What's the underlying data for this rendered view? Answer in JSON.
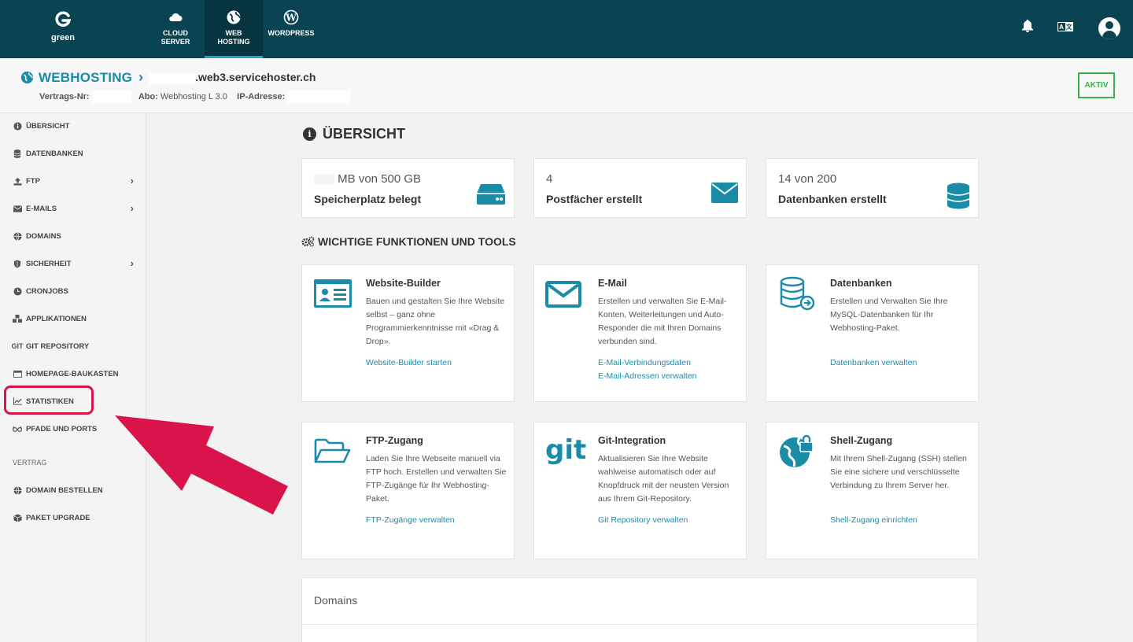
{
  "topnav": {
    "logo_text": "green",
    "tabs": [
      {
        "label_line1": "CLOUD",
        "label_line2": "SERVER",
        "icon": "cloud-icon"
      },
      {
        "label_line1": "WEB",
        "label_line2": "HOSTING",
        "icon": "globe-icon",
        "active": true
      },
      {
        "label_line1": "WORDPRESS",
        "label_line2": "",
        "icon": "wordpress-icon"
      }
    ],
    "icons": [
      "bell-icon",
      "translate-icon",
      "user-avatar-icon"
    ]
  },
  "header": {
    "title": "WEBHOSTING",
    "domain_suffix": ".web3.servicehoster.ch",
    "contract_label": "Vertrags-Nr:",
    "abo_label": "Abo:",
    "abo_value": "Webhosting L 3.0",
    "ip_label": "IP-Adresse:",
    "status": "AKTIV"
  },
  "sidebar": {
    "items": [
      {
        "label": "ÜBERSICHT",
        "icon": "info-icon"
      },
      {
        "label": "DATENBANKEN",
        "icon": "database-icon"
      },
      {
        "label": "FTP",
        "icon": "upload-icon",
        "has_submenu": true
      },
      {
        "label": "E-MAILS",
        "icon": "envelope-icon",
        "has_submenu": true
      },
      {
        "label": "DOMAINS",
        "icon": "globe-icon"
      },
      {
        "label": "SICHERHEIT",
        "icon": "shield-icon",
        "has_submenu": true
      },
      {
        "label": "CRONJOBS",
        "icon": "clock-icon"
      },
      {
        "label": "APPLIKATIONEN",
        "icon": "cubes-icon"
      },
      {
        "label": "GIT REPOSITORY",
        "icon": "git-icon"
      },
      {
        "label": "HOMEPAGE-BAUKASTEN",
        "icon": "window-icon"
      },
      {
        "label": "STATISTIKEN",
        "icon": "chart-line-icon"
      },
      {
        "label": "PFADE UND PORTS",
        "icon": "glasses-icon"
      }
    ],
    "section_label": "VERTRAG",
    "contract_items": [
      {
        "label": "DOMAIN BESTELLEN",
        "icon": "globe-icon"
      },
      {
        "label": "PAKET UPGRADE",
        "icon": "box-icon"
      }
    ]
  },
  "main": {
    "title": "ÜBERSICHT",
    "stats": [
      {
        "value": "MB von 500 GB",
        "label": "Speicherplatz belegt",
        "icon": "hdd-icon"
      },
      {
        "value": "4",
        "label": "Postfächer erstellt",
        "icon": "envelope-icon"
      },
      {
        "value": "14 von 200",
        "label": "Datenbanken erstellt",
        "icon": "database-icon"
      }
    ],
    "tools_title": "WICHTIGE FUNKTIONEN UND TOOLS",
    "cards": [
      {
        "title": "Website-Builder",
        "desc": "Bauen und gestalten Sie Ihre Website selbst – ganz ohne Programmierkenntnisse mit «Drag & Drop».",
        "links": [
          "Website-Builder starten"
        ],
        "icon": "id-card-icon"
      },
      {
        "title": "E-Mail",
        "desc": "Erstellen und verwalten Sie E-Mail-Konten, Weiterleitungen und Auto-Responder die mit Ihren Domains verbunden sind.",
        "links": [
          "E-Mail-Verbindungsdaten",
          "E-Mail-Adressen verwalten"
        ],
        "icon": "envelope-icon"
      },
      {
        "title": "Datenbanken",
        "desc": "Erstellen und Verwalten Sie Ihre MySQL-Datenbanken für Ihr Webhosting-Paket.",
        "links": [
          "Datenbanken verwalten"
        ],
        "icon": "database-arrow-icon"
      },
      {
        "title": "FTP-Zugang",
        "desc": "Laden Sie Ihre Webseite manuell via FTP hoch. Erstellen und verwalten Sie FTP-Zugänge für Ihr Webhosting-Paket.",
        "links": [
          "FTP-Zugänge verwalten"
        ],
        "icon": "folder-open-icon"
      },
      {
        "title": "Git-Integration",
        "desc": "Aktualisieren Sie Ihre Website wahlweise automatisch oder auf Knopfdruck mit der neusten Version aus Ihrem Git-Repository.",
        "links": [
          "Git Repository verwalten"
        ],
        "icon": "git-icon",
        "icon_text": "git"
      },
      {
        "title": "Shell-Zugang",
        "desc": "Mit Ihrem Shell-Zugang (SSH) stellen Sie eine sichere und verschlüsselte Verbindung zu Ihrem Server her.",
        "links": [
          "Shell-Zugang einrichten"
        ],
        "icon": "globe-lock-icon"
      }
    ],
    "domains_title": "Domains"
  },
  "colors": {
    "topbar": "#0a4452",
    "accent": "#1a8ca8",
    "status_green": "#3cb04a",
    "highlight_red": "#d9144a"
  }
}
